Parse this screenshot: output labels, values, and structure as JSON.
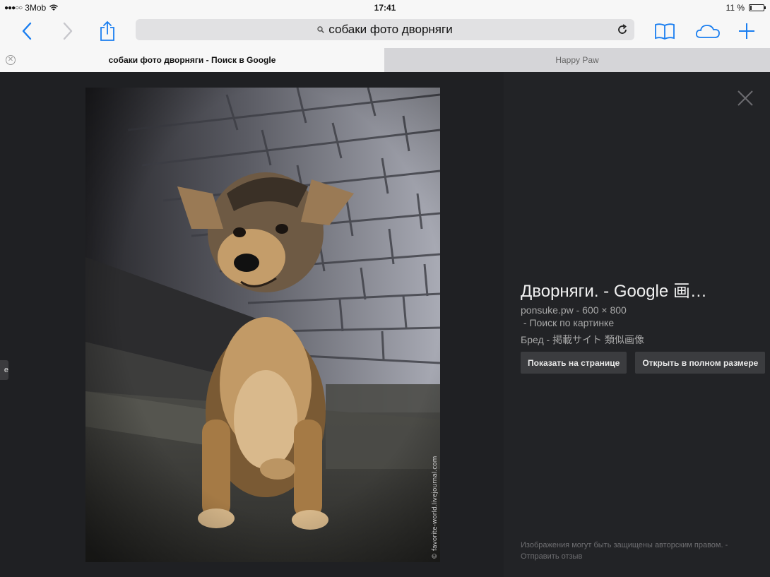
{
  "status_bar": {
    "carrier": "3Mob",
    "time": "17:41",
    "battery": "11 %",
    "battery_level": 0.11
  },
  "toolbar": {
    "address": "собаки фото дворняги",
    "icons": [
      "back-icon",
      "forward-icon",
      "share-icon",
      "reload-icon",
      "bookmarks-icon",
      "icloud-tabs-icon",
      "new-tab-icon"
    ]
  },
  "tabs": [
    {
      "label": "собаки фото дворняги - Поиск в Google",
      "active": true
    },
    {
      "label": "Happy Paw",
      "active": false
    }
  ],
  "viewer": {
    "side_tab_label": "e",
    "title": "Дворняги. - Google 画…",
    "source": "ponsuke.pw",
    "dimensions": "600 × 800",
    "search_by_image": "Поиск по картинке",
    "related": "Бред - 掲載サイト 類似画像",
    "buttons": {
      "show_on_page": "Показать на странице",
      "open_full": "Открыть в полном размере"
    },
    "footnote": "Изображения могут быть защищены авторским правом. - Отправить отзыв",
    "photo_watermark": "© favorite-world.livejournal.com"
  },
  "colors": {
    "accent": "#1a7ef0",
    "viewer_bg": "#222326"
  }
}
